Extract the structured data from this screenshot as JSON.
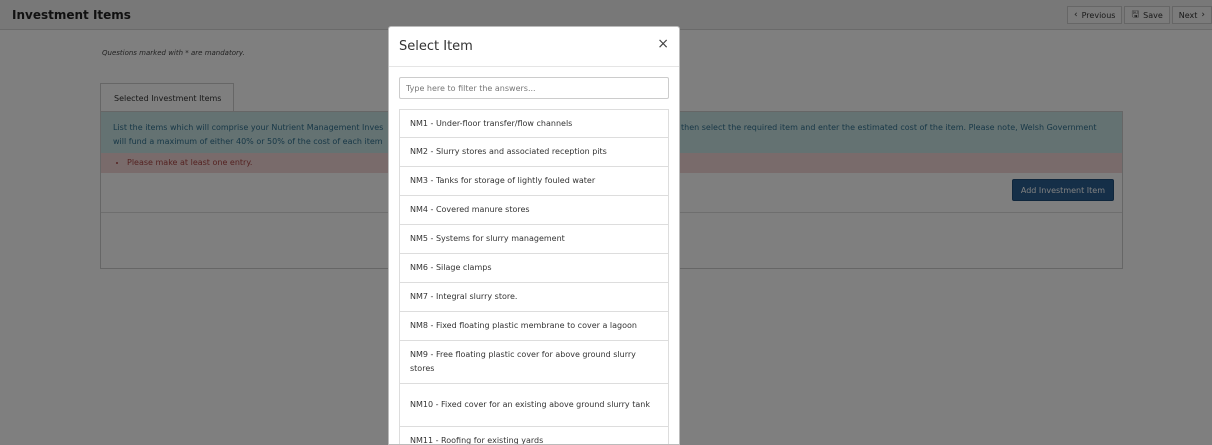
{
  "page": {
    "title": "Investment Items",
    "nav": {
      "previous": "Previous",
      "save": "Save",
      "next": "Next"
    },
    "mandatory_note": "Questions marked with * are mandatory.",
    "tab_label": "Selected Investment Items",
    "info_left": "List the items which will comprise your Nutrient Management Inves will fund a maximum of either 40% or 50% of the cost of each item",
    "info_right": "then select the required item and enter the estimated cost of the item. Please note, Welsh Government",
    "error_message": "Please make at least one entry.",
    "add_button": "Add Investment Item"
  },
  "modal": {
    "title": "Select Item",
    "close_glyph": "×",
    "filter_placeholder": "Type here to filter the answers...",
    "items": [
      "NM1 - Under-floor transfer/flow channels",
      "NM2 - Slurry stores and associated reception pits",
      "NM3 - Tanks for storage of lightly fouled water",
      "NM4 - Covered manure stores",
      "NM5 - Systems for slurry management",
      "NM6 - Silage clamps",
      "NM7 - Integral slurry store.",
      "NM8 - Fixed floating plastic membrane to cover a lagoon",
      "NM9 - Free floating plastic cover for above ground slurry stores",
      "NM10 - Fixed cover for an existing above ground slurry tank",
      "NM11 - Roofing for existing yards"
    ]
  },
  "icons": {
    "previous": "chevron-left-icon",
    "save": "floppy-disk-icon",
    "next": "chevron-right-icon",
    "close": "close-icon"
  },
  "colors": {
    "accent_button": "#2a5f91",
    "info_bg": "#c9e5e5",
    "error_bg": "#f2d7d7"
  }
}
